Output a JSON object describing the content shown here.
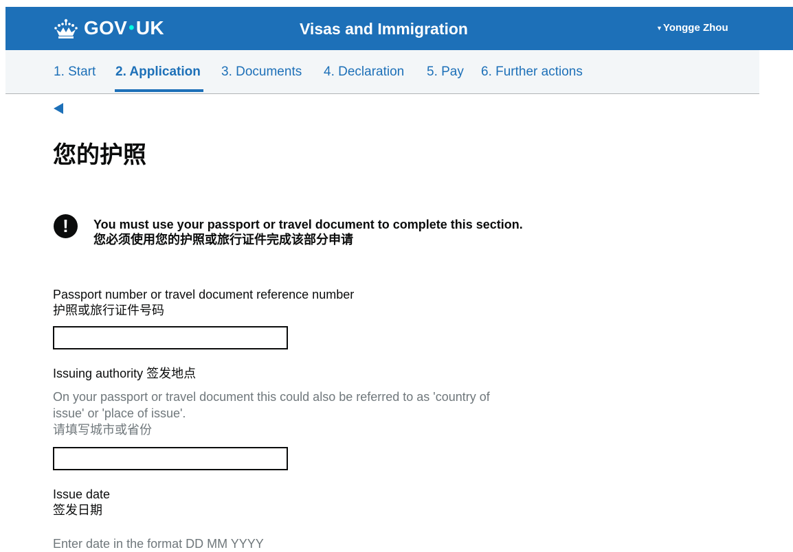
{
  "header": {
    "logo_text_1": "GOV",
    "logo_separator": "•",
    "logo_text_2": "UK",
    "logo_icon": "crown-icon",
    "service_name": "Visas and Immigration",
    "user_menu": {
      "caret": "▼",
      "user_name": "Yongge Zhou"
    },
    "background_color": "#1d70b8"
  },
  "nav": {
    "items": [
      {
        "label": "1. Start",
        "active": false
      },
      {
        "label": "2. Application",
        "active": true
      },
      {
        "label": "3. Documents",
        "active": false
      },
      {
        "label": "4. Declaration",
        "active": false
      },
      {
        "label": "5. Pay",
        "active": false
      },
      {
        "label": "6. Further actions",
        "active": false
      }
    ],
    "accent_color": "#1d70b8"
  },
  "back": {
    "icon": "back-arrow-icon"
  },
  "page": {
    "title": "您的护照"
  },
  "warning": {
    "icon_glyph": "!",
    "line_1": "You must use your passport or travel document to complete this section.",
    "line_2": "您必须使用您的护照或旅行证件完成该部分申请"
  },
  "form": {
    "passport_number": {
      "label_en": "Passport number or travel document reference number",
      "label_zh": "护照或旅行证件号码",
      "value": ""
    },
    "issuing_authority": {
      "label": "Issuing authority 签发地点",
      "hint_line_1": "On your passport or travel document this could also be referred to as 'country of",
      "hint_line_2": "issue' or 'place of issue'.",
      "hint_line_3": "请填写城市或省份",
      "value": ""
    },
    "issue_date": {
      "label_en": "Issue date",
      "label_zh": "签发日期",
      "hint": "Enter date in the format DD MM YYYY"
    }
  }
}
